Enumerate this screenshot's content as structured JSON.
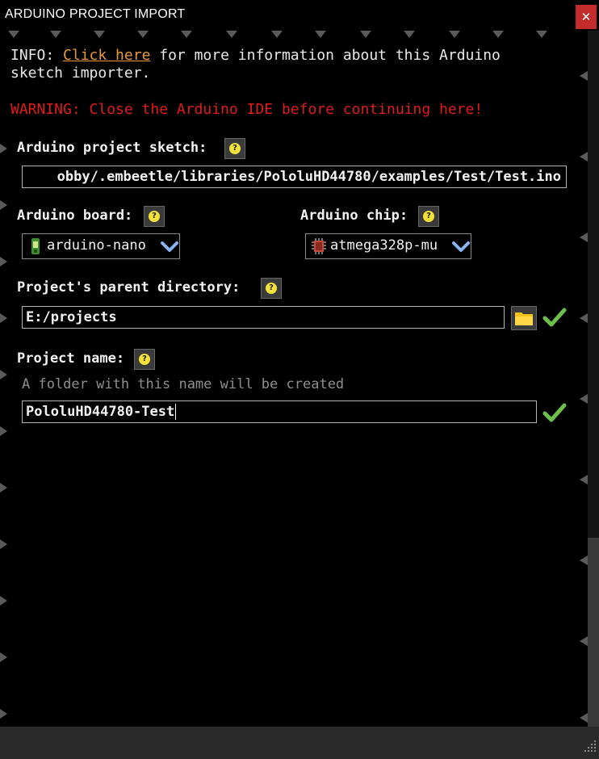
{
  "window": {
    "title": "ARDUINO PROJECT IMPORT",
    "close_symbol": "✕"
  },
  "info": {
    "prefix": "INFO: ",
    "link_text": "Click here",
    "suffix_line1": " for more information about this Arduino",
    "line2": "sketch importer."
  },
  "warning": "WARNING: Close the Arduino IDE before continuing here!",
  "sketch": {
    "label": "Arduino project sketch:",
    "value": "obby/.embeetle/libraries/PololuHD44780/examples/Test/Test.ino"
  },
  "board": {
    "label": "Arduino board:",
    "value": "arduino-nano",
    "icon": "board-icon"
  },
  "chip": {
    "label": "Arduino chip:",
    "value": "atmega328p-mu",
    "icon": "chip-icon"
  },
  "parent_dir": {
    "label": "Project's parent directory:",
    "value": "E:/projects",
    "valid": true
  },
  "project_name": {
    "label": "Project name:",
    "hint": "A folder with this name will be created",
    "value": "PololuHD44780-Test",
    "valid": true
  },
  "help_symbol": "?",
  "colors": {
    "link": "#e89a3c",
    "warning": "#e01b1b",
    "check": "#6cc04a",
    "help": "#f4e23a",
    "close": "#c42b2b"
  }
}
